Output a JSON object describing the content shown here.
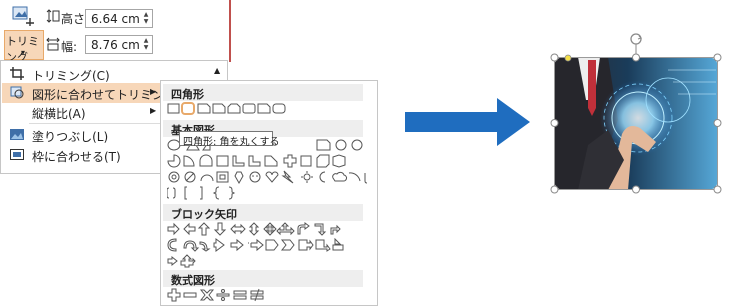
{
  "ribbon": {
    "height_label": "高さ:",
    "height_value": "6.64 cm",
    "width_label": "幅:",
    "width_value": "8.76 cm",
    "trim_button_label": "トリミング"
  },
  "menu": {
    "items": [
      {
        "label": "トリミング(C)",
        "icon": "crop-icon"
      },
      {
        "label": "図形に合わせてトリミング(S)",
        "icon": "shape-crop-icon"
      },
      {
        "label": "縦横比(A)",
        "icon": ""
      },
      {
        "label": "塗りつぶし(L)",
        "icon": "fill-picture-icon"
      },
      {
        "label": "枠に合わせる(T)",
        "icon": "fit-picture-icon"
      }
    ]
  },
  "submenu": {
    "sections": [
      {
        "title": "四角形"
      },
      {
        "title": "基本図形"
      },
      {
        "title": "ブロック矢印"
      },
      {
        "title": "数式図形"
      }
    ]
  },
  "tooltip": {
    "text": "四角形: 角を丸くする"
  },
  "colors": {
    "accent": "#1f6dbf",
    "highlight": "#f7d7b9",
    "highlight_border": "#e8a96a"
  }
}
